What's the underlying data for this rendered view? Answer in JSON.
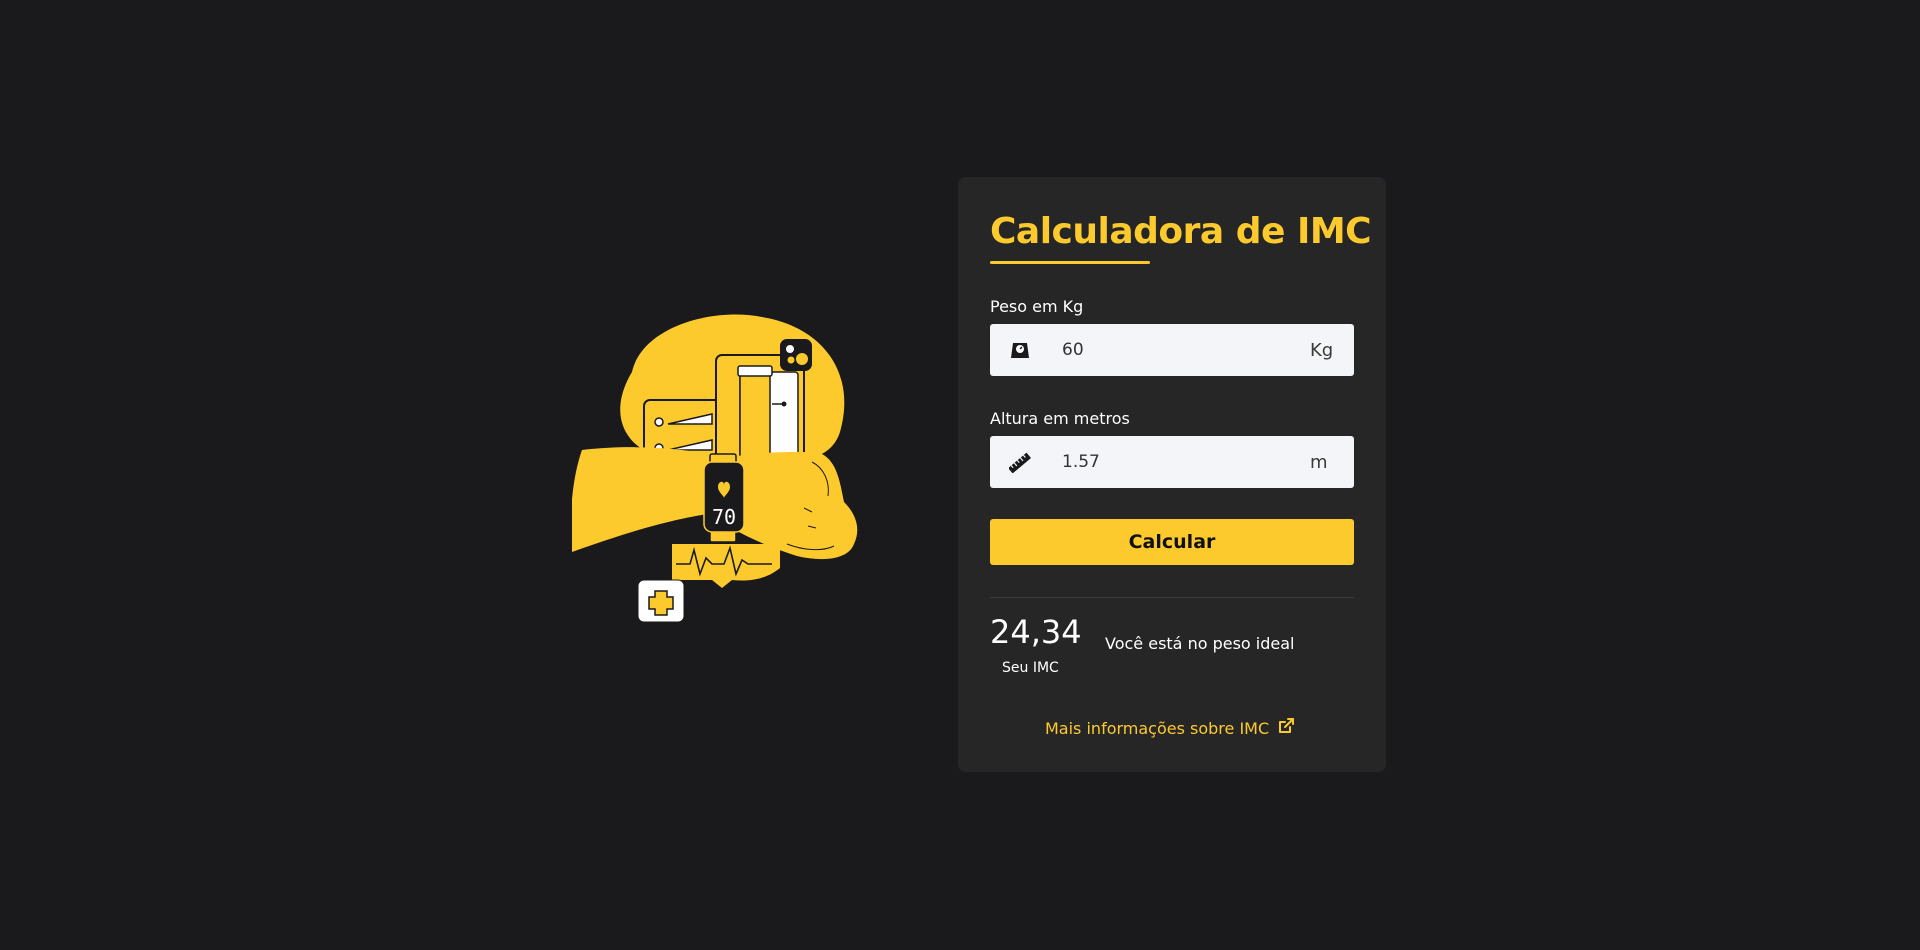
{
  "calculator": {
    "title": "Calculadora de IMC",
    "weight": {
      "label": "Peso em Kg",
      "value": "60",
      "unit": "Kg",
      "icon": "scale-icon"
    },
    "height": {
      "label": "Altura em metros",
      "value": "1.57",
      "unit": "m",
      "icon": "ruler-icon"
    },
    "calculate_label": "Calcular",
    "result": {
      "value": "24,34",
      "caption": "Seu IMC",
      "message": "Você está no peso ideal"
    },
    "more_info_label": "Mais informações sobre IMC",
    "more_info_icon": "external-link-icon"
  },
  "illustration": {
    "watch_reading": "70"
  },
  "colors": {
    "background": "#1a1a1c",
    "card": "#262626",
    "accent": "#fdca2e",
    "input_bg": "#f3f5f8"
  }
}
